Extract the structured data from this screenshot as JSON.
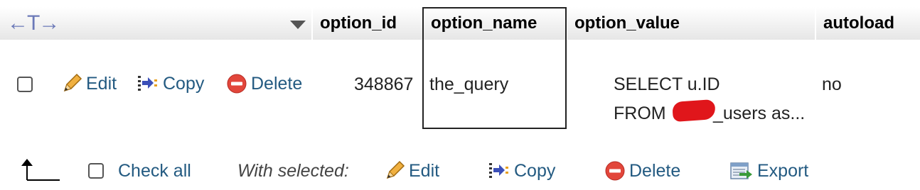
{
  "header": {
    "arrows_glyph": "←T→",
    "columns": [
      "option_id",
      "option_name",
      "option_value",
      "autoload"
    ]
  },
  "row": {
    "edit_label": "Edit",
    "copy_label": "Copy",
    "delete_label": "Delete",
    "option_id": "348867",
    "option_name": "the_query",
    "option_value_line1": "SELECT u.ID",
    "option_value_line2_prefix": "FROM ",
    "option_value_line2_suffix": "_users as...",
    "autoload": "no"
  },
  "footer": {
    "check_all_label": "Check all",
    "with_selected_label": "With selected:",
    "edit_label": "Edit",
    "copy_label": "Copy",
    "delete_label": "Delete",
    "export_label": "Export"
  },
  "colors": {
    "link": "#235a81",
    "arrows": "#6b79b8",
    "redaction": "#e0161b",
    "delete_icon": "#e2463b"
  },
  "icons": [
    "pencil-icon",
    "copy-icon",
    "delete-icon",
    "export-icon",
    "sort-arrow-icon",
    "return-arrow-icon"
  ]
}
